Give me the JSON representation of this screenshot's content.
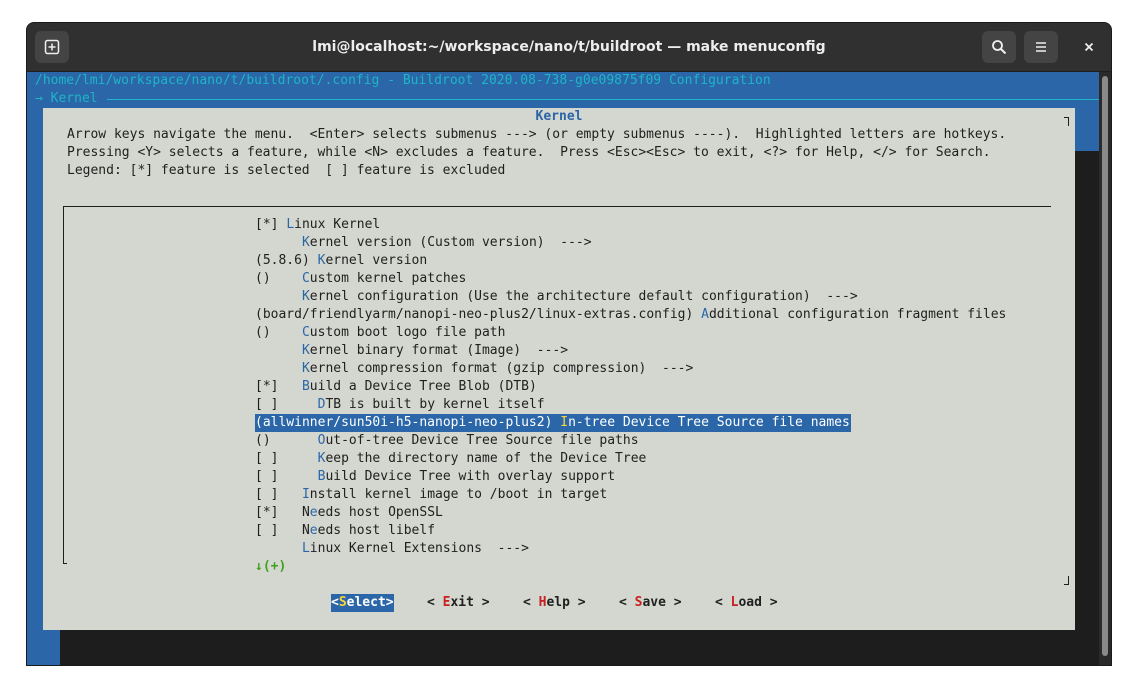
{
  "window": {
    "title": "lmi@localhost:~/workspace/nano/t/buildroot — make menuconfig",
    "new_tab_icon": "new-tab-icon",
    "search_icon": "search-icon",
    "menu_icon": "hamburger-menu-icon",
    "close_icon": "close-icon"
  },
  "terminal": {
    "header": "/home/lmi/workspace/nano/t/buildroot/.config - Buildroot 2020.08-738-g0e09875f09 Configuration",
    "breadcrumb": "→ Kernel",
    "dialog_title": "Kernel",
    "help_lines": [
      "Arrow keys navigate the menu.  <Enter> selects submenus ---> (or empty submenus ----).  Highlighted letters are hotkeys.",
      "Pressing <Y> selects a feature, while <N> excludes a feature.  Press <Esc><Esc> to exit, <?> for Help, </> for Search.",
      "Legend: [*] feature is selected  [ ] feature is excluded"
    ],
    "menu_items": [
      {
        "pre": "[*] ",
        "hot": "L",
        "post": "inux Kernel",
        "selected": false
      },
      {
        "pre": "      ",
        "hot": "K",
        "post": "ernel version (Custom version)  --->",
        "selected": false
      },
      {
        "pre": "(5.8.6) ",
        "hot": "K",
        "post": "ernel version",
        "selected": false
      },
      {
        "pre": "()    ",
        "hot": "C",
        "post": "ustom kernel patches",
        "selected": false
      },
      {
        "pre": "      ",
        "hot": "K",
        "post": "ernel configuration (Use the architecture default configuration)  --->",
        "selected": false
      },
      {
        "pre": "(board/friendlyarm/nanopi-neo-plus2/linux-extras.config) ",
        "hot": "A",
        "post": "dditional configuration fragment files",
        "selected": false
      },
      {
        "pre": "()    ",
        "hot": "C",
        "post": "ustom boot logo file path",
        "selected": false
      },
      {
        "pre": "      ",
        "hot": "K",
        "post": "ernel binary format (Image)  --->",
        "selected": false
      },
      {
        "pre": "      ",
        "hot": "K",
        "post": "ernel compression format (gzip compression)  --->",
        "selected": false
      },
      {
        "pre": "[*]   ",
        "hot": "B",
        "post": "uild a Device Tree Blob (DTB)",
        "selected": false
      },
      {
        "pre": "[ ]     ",
        "hot": "D",
        "post": "TB is built by kernel itself",
        "selected": false
      },
      {
        "pre": "(allwinner/sun50i-h5-nanopi-neo-plus2) ",
        "hot": "I",
        "post": "n-tree Device Tree Source file names",
        "selected": true
      },
      {
        "pre": "()      ",
        "hot": "O",
        "post": "ut-of-tree Device Tree Source file paths",
        "selected": false
      },
      {
        "pre": "[ ]     ",
        "hot": "K",
        "post": "eep the directory name of the Device Tree",
        "selected": false
      },
      {
        "pre": "[ ]     ",
        "hot": "B",
        "post": "uild Device Tree with overlay support",
        "selected": false
      },
      {
        "pre": "[ ]   ",
        "hot": "I",
        "post": "nstall kernel image to /boot in target",
        "selected": false
      },
      {
        "pre": "[*]   N",
        "hot": "e",
        "post": "eds host OpenSSL",
        "selected": false
      },
      {
        "pre": "[ ]   N",
        "hot": "e",
        "post": "eds host libelf",
        "selected": false
      },
      {
        "pre": "      ",
        "hot": "L",
        "post": "inux Kernel Extensions  --->",
        "selected": false
      }
    ],
    "more_indicator": "↓(+)",
    "buttons": [
      {
        "pre": "<",
        "hot": "S",
        "post": "elect>",
        "selected": true
      },
      {
        "pre": "< ",
        "hot": "E",
        "post": "xit >",
        "selected": false
      },
      {
        "pre": "< ",
        "hot": "H",
        "post": "elp >",
        "selected": false
      },
      {
        "pre": "< ",
        "hot": "S",
        "post": "ave >",
        "selected": false
      },
      {
        "pre": "< ",
        "hot": "L",
        "post": "oad >",
        "selected": false
      }
    ]
  },
  "colors": {
    "terminal_bg": "#2a66a8",
    "dialog_bg": "#d3d7cf",
    "header_text": "#1fb5c5",
    "hotkey": "#2a66a8",
    "hotkey_selected": "#ffd43b",
    "button_hotkey": "#c81f1f",
    "more_indicator": "#3fa01d"
  }
}
